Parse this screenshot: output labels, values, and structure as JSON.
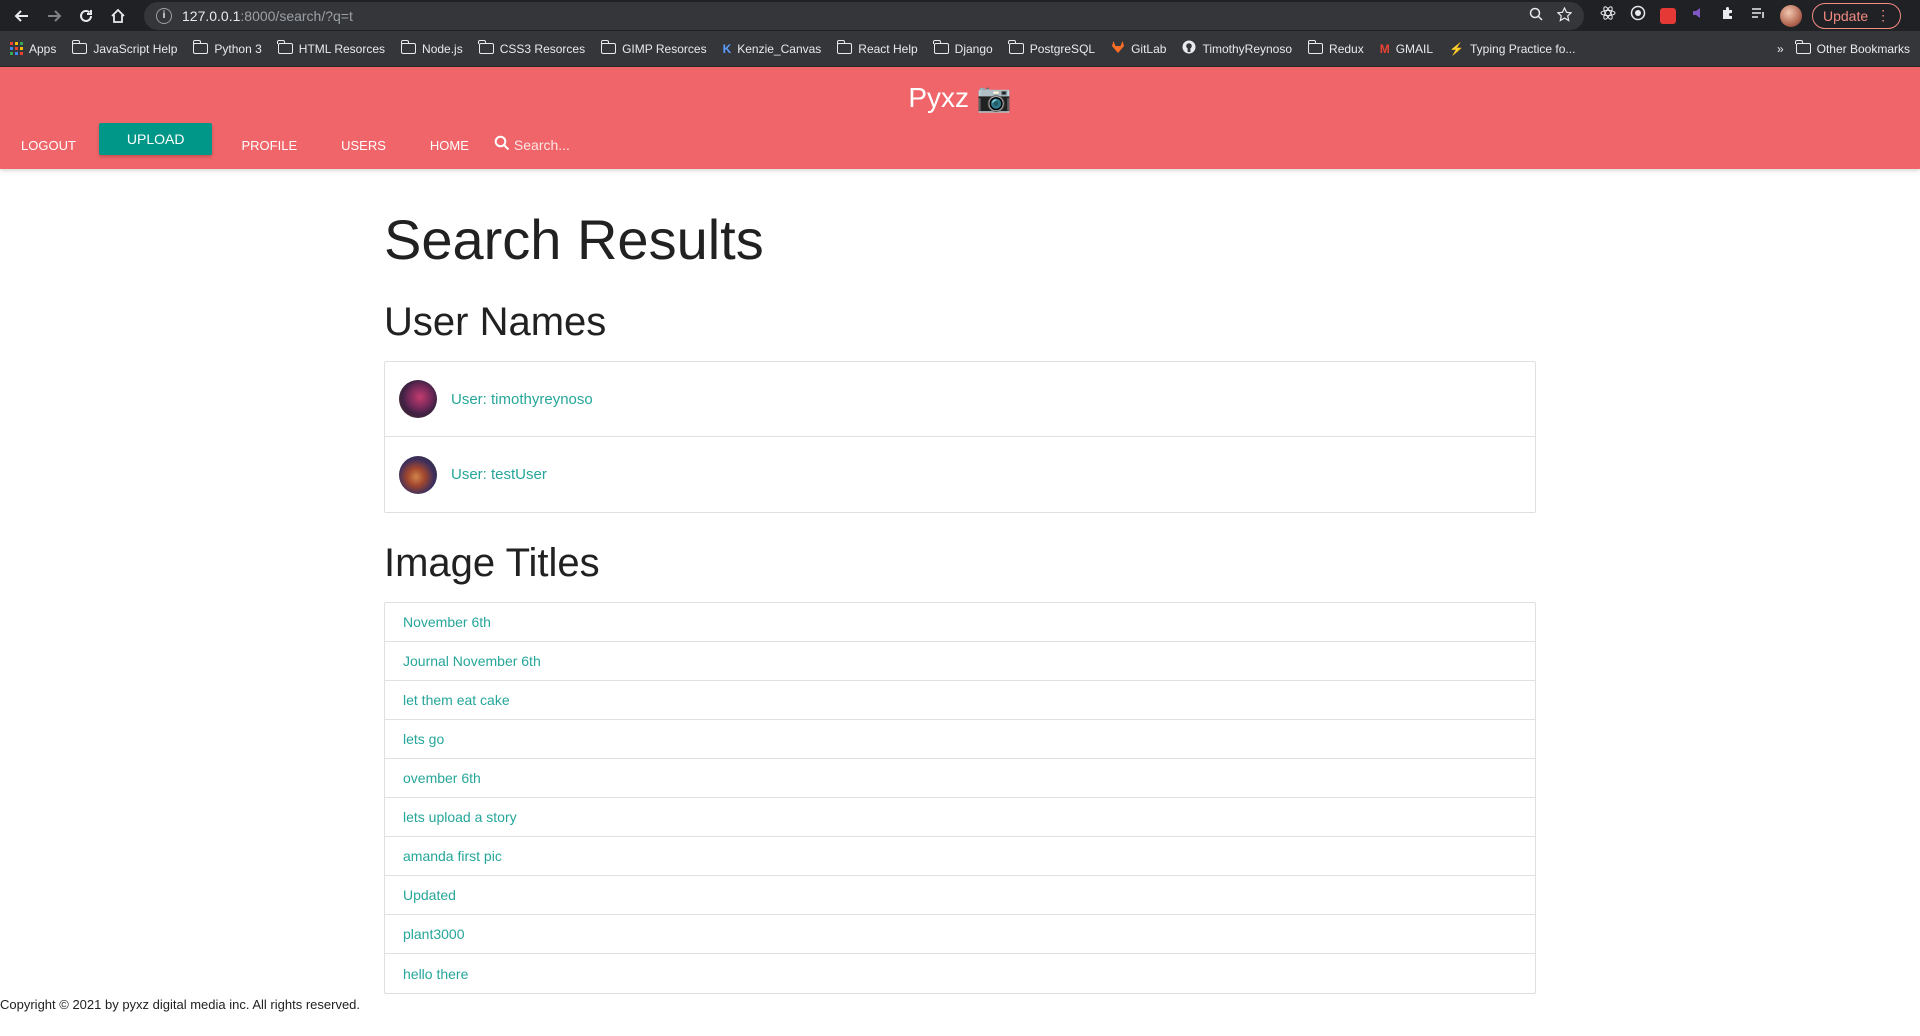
{
  "browser": {
    "url_host": "127.0.0.1",
    "url_rest": ":8000/search/?q=t",
    "update_label": "Update",
    "bookmarks": [
      {
        "label": "Apps",
        "icon": "apps-grid-icon"
      },
      {
        "label": "JavaScript Help",
        "icon": "folder-icon"
      },
      {
        "label": "Python 3",
        "icon": "folder-icon"
      },
      {
        "label": "HTML Resorces",
        "icon": "folder-icon"
      },
      {
        "label": "Node.js",
        "icon": "folder-icon"
      },
      {
        "label": "CSS3 Resorces",
        "icon": "folder-icon"
      },
      {
        "label": "GIMP Resorces",
        "icon": "folder-icon"
      },
      {
        "label": "Kenzie_Canvas",
        "icon": "kenzie-icon"
      },
      {
        "label": "React Help",
        "icon": "folder-icon"
      },
      {
        "label": "Django",
        "icon": "folder-icon"
      },
      {
        "label": "PostgreSQL",
        "icon": "folder-icon"
      },
      {
        "label": "GitLab",
        "icon": "gitlab-icon"
      },
      {
        "label": "TimothyReynoso",
        "icon": "github-icon"
      },
      {
        "label": "Redux",
        "icon": "folder-icon"
      },
      {
        "label": "GMAIL",
        "icon": "gmail-icon"
      },
      {
        "label": "Typing Practice fo...",
        "icon": "bolt-icon"
      }
    ],
    "overflow_label": "»",
    "other_bookmarks": "Other Bookmarks"
  },
  "app": {
    "brand": "Pyxz 📷",
    "nav": {
      "logout": "LOGOUT",
      "upload": "UPLOAD",
      "profile": "PROFILE",
      "users": "USERS",
      "home": "HOME"
    },
    "search_placeholder": "Search..."
  },
  "page": {
    "title": "Search Results",
    "users_heading": "User Names",
    "users": [
      {
        "label": "User: timothyreynoso"
      },
      {
        "label": "User: testUser"
      }
    ],
    "images_heading": "Image Titles",
    "images": [
      "November 6th",
      "Journal November 6th",
      "let them eat cake",
      "lets go",
      "ovember 6th",
      "lets upload a story",
      "amanda first pic",
      "Updated",
      "plant3000",
      "hello there"
    ]
  },
  "footer": "Copyright © 2021 by pyxz digital media inc. All rights reserved.",
  "colors": {
    "header": "#ef6569",
    "upload_button": "#009688",
    "link": "#26a69a"
  }
}
